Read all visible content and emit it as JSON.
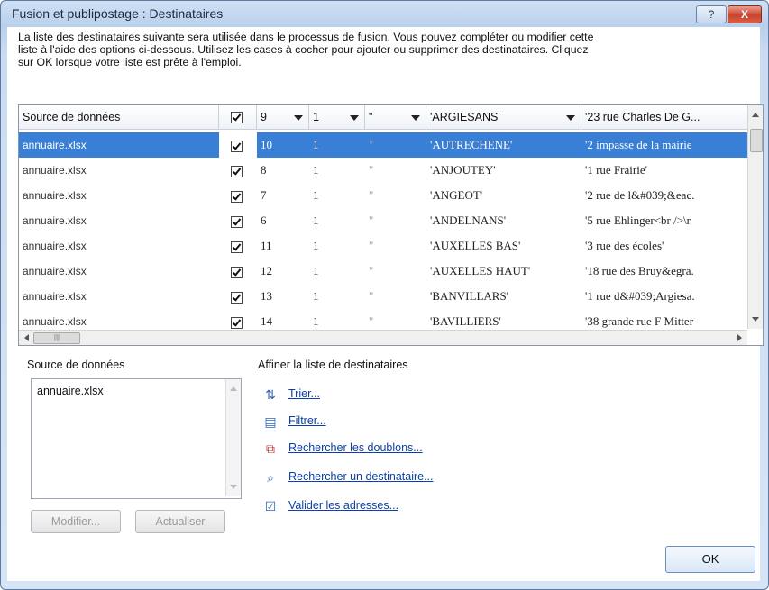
{
  "window": {
    "title": "Fusion et publipostage : Destinataires",
    "help_label": "?",
    "close_label": "X"
  },
  "description": [
    "La liste des destinataires suivante sera utilisée dans le processus de fusion. Vous pouvez compléter ou modifier cette",
    "liste à l'aide des options ci-dessous. Utilisez les cases à cocher pour ajouter ou supprimer des destinataires. Cliquez",
    "sur OK lorsque votre liste est prête à l'emploi."
  ],
  "grid": {
    "headers": [
      "Source de données",
      "",
      "9",
      "1",
      "\"",
      "'ARGIESANS'",
      "'23 rue Charles De G..."
    ],
    "rows": [
      {
        "source": "annuaire.xlsx",
        "checked": true,
        "c9": "10",
        "c1": "1",
        "q": "\"",
        "name": "'AUTRECHENE'",
        "addr": "'2 impasse de la mairie",
        "selected": true
      },
      {
        "source": "annuaire.xlsx",
        "checked": true,
        "c9": "8",
        "c1": "1",
        "q": "\"",
        "name": "'ANJOUTEY'",
        "addr": "'1 rue Frairie'"
      },
      {
        "source": "annuaire.xlsx",
        "checked": true,
        "c9": "7",
        "c1": "1",
        "q": "\"",
        "name": "'ANGEOT'",
        "addr": "'2 rue de l&#039;&eac."
      },
      {
        "source": "annuaire.xlsx",
        "checked": true,
        "c9": "6",
        "c1": "1",
        "q": "\"",
        "name": "'ANDELNANS'",
        "addr": "'5 rue Ehlinger<br />\\r"
      },
      {
        "source": "annuaire.xlsx",
        "checked": true,
        "c9": "11",
        "c1": "1",
        "q": "\"",
        "name": "'AUXELLES BAS'",
        "addr": "'3 rue des écoles'"
      },
      {
        "source": "annuaire.xlsx",
        "checked": true,
        "c9": "12",
        "c1": "1",
        "q": "\"",
        "name": "'AUXELLES HAUT'",
        "addr": "'18 rue des Bruy&egra."
      },
      {
        "source": "annuaire.xlsx",
        "checked": true,
        "c9": "13",
        "c1": "1",
        "q": "\"",
        "name": "'BANVILLARS'",
        "addr": "'1 rue d&#039;Argiesa."
      },
      {
        "source": "annuaire.xlsx",
        "checked": true,
        "c9": "14",
        "c1": "1",
        "q": "\"",
        "name": "'BAVILLIERS'",
        "addr": "'38 grande rue F Mitter"
      }
    ]
  },
  "source_panel": {
    "label": "Source de données",
    "items": [
      "annuaire.xlsx"
    ],
    "modify_label": "Modifier...",
    "refresh_label": "Actualiser"
  },
  "refine": {
    "label": "Affiner la liste de destinataires",
    "links": [
      "Trier...",
      "Filtrer...",
      "Rechercher les doublons...",
      "Rechercher un destinataire...",
      "Valider les adresses..."
    ]
  },
  "ok_label": "OK"
}
